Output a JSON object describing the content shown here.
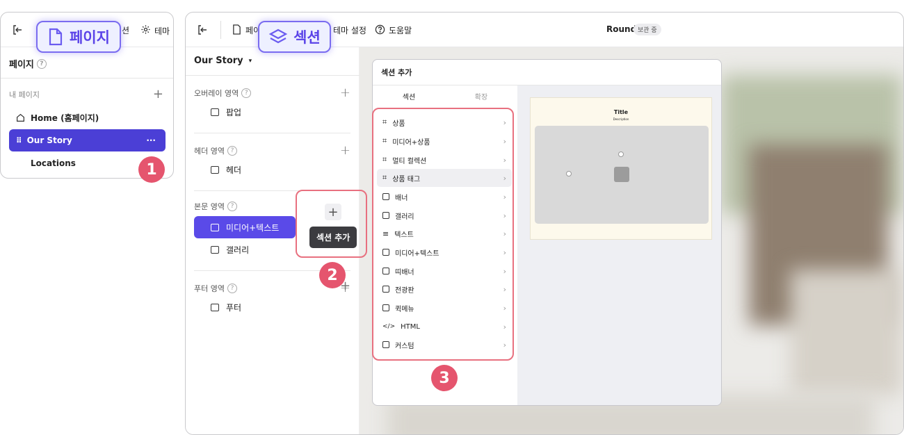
{
  "left_panel": {
    "toolbar_text_1": "션",
    "toolbar_text_2": "테마",
    "callout_label": "페이지",
    "page_title": "페이지",
    "my_pages_label": "내 페이지",
    "pages": [
      {
        "label": "Home (홈페이지)"
      },
      {
        "label": "Our Story"
      },
      {
        "label": "Locations"
      }
    ],
    "active_more": "···",
    "step": "1"
  },
  "right_panel": {
    "toolbar": {
      "page_label": "페이",
      "callout_label": "섹션",
      "theme_label": "테마 설정",
      "help_label": "도움말",
      "site_name": "Round",
      "status_badge": "보관 중"
    },
    "page_selector": "Our Story",
    "groups": [
      {
        "label": "오버레이 영역",
        "items": [
          "팝업"
        ]
      },
      {
        "label": "헤더 영역",
        "items": [
          "헤더"
        ]
      },
      {
        "label": "본문 영역",
        "items": [
          "미디어+텍스트",
          "갤러리"
        ]
      },
      {
        "label": "푸터 영역",
        "items": [
          "푸터"
        ]
      }
    ],
    "tooltip": "섹션 추가",
    "step2": "2",
    "step3": "3"
  },
  "modal": {
    "title": "섹션 추가",
    "tabs": [
      "섹션",
      "확장"
    ],
    "items": [
      {
        "label": "상품",
        "icon": "tag-icon"
      },
      {
        "label": "미디어+상품",
        "icon": "tag-icon"
      },
      {
        "label": "멀티 컬렉션",
        "icon": "tag-icon"
      },
      {
        "label": "상품 태그",
        "icon": "tag-icon"
      },
      {
        "label": "배너",
        "icon": "image-icon"
      },
      {
        "label": "갤러리",
        "icon": "image-icon"
      },
      {
        "label": "텍스트",
        "icon": "text-icon"
      },
      {
        "label": "미디어+텍스트",
        "icon": "image-icon"
      },
      {
        "label": "띠배너",
        "icon": "layout-icon"
      },
      {
        "label": "전광판",
        "icon": "layout-icon"
      },
      {
        "label": "퀵메뉴",
        "icon": "layout-icon"
      },
      {
        "label": "HTML",
        "icon": "code-icon"
      },
      {
        "label": "커스텀",
        "icon": "layout-icon"
      }
    ],
    "preview": {
      "title": "Title",
      "description": "Description"
    }
  },
  "colors": {
    "accent": "#4b3fd6",
    "highlight": "#7a6cf0",
    "step": "#e5556e"
  }
}
